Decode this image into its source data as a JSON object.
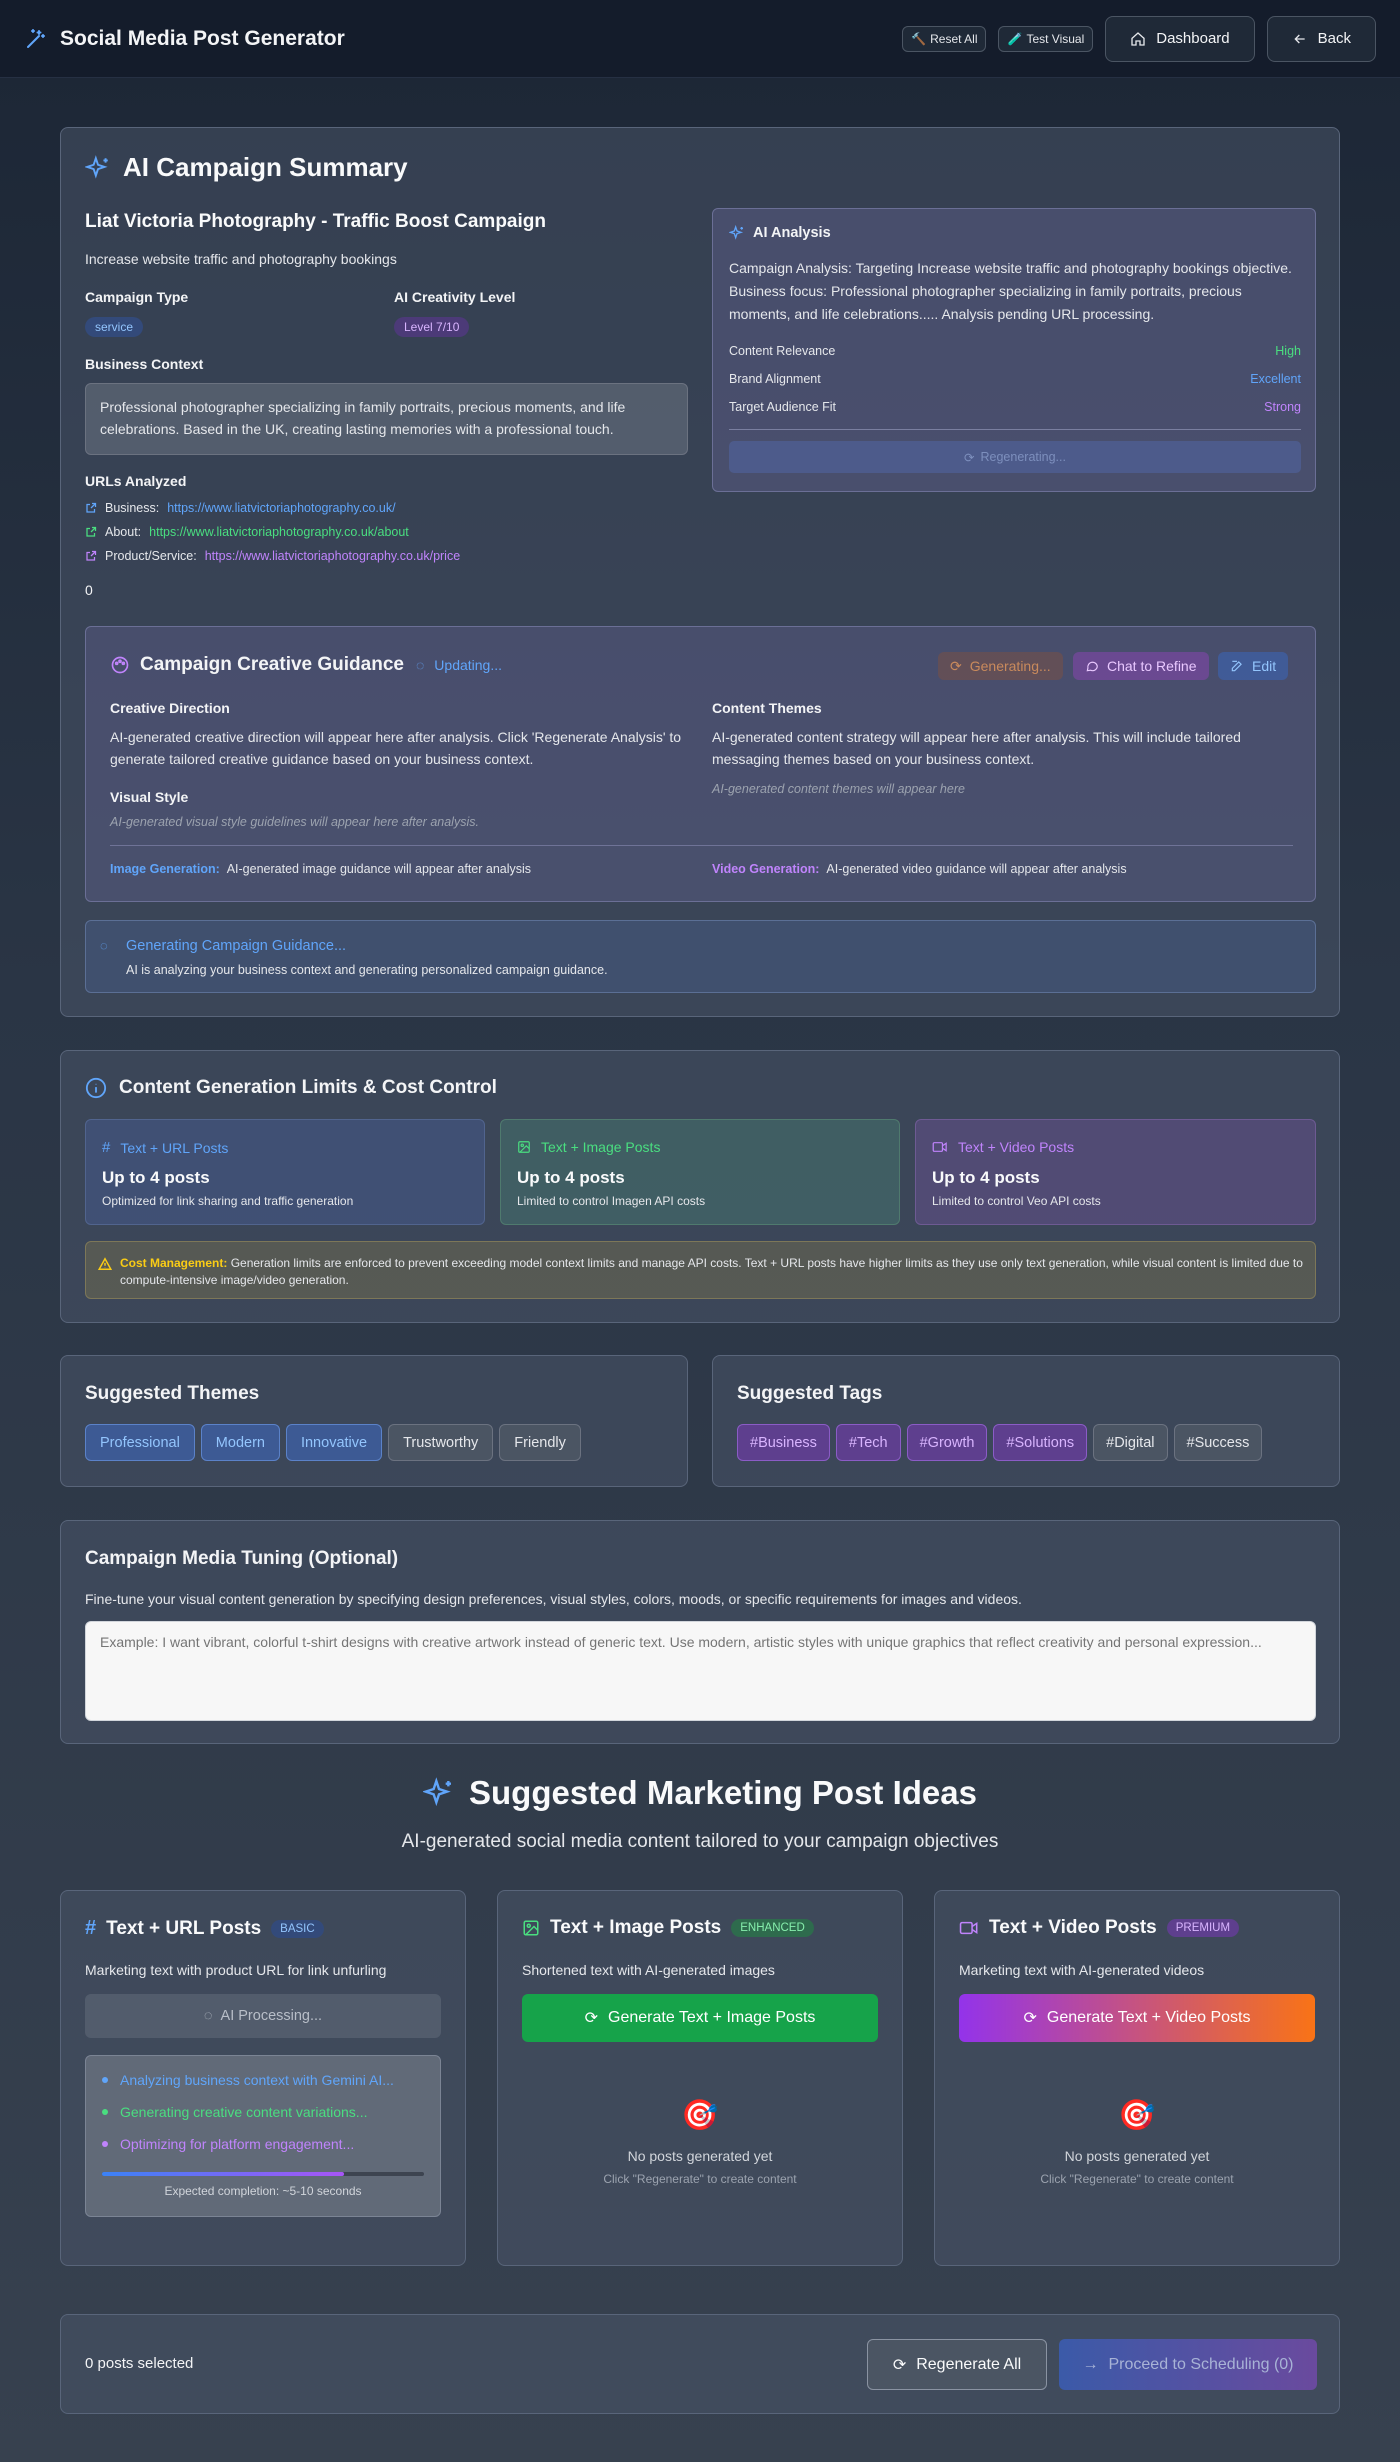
{
  "header": {
    "title": "Social Media Post Generator",
    "reset_all": "Reset All",
    "test_visual": "Test Visual",
    "dashboard": "Dashboard",
    "back": "Back"
  },
  "summary": {
    "heading": "AI Campaign Summary",
    "campaign_name": "Liat Victoria Photography - Traffic Boost Campaign",
    "objective": "Increase website traffic and photography bookings",
    "campaign_type_label": "Campaign Type",
    "campaign_type": "service",
    "creativity_label": "AI Creativity Level",
    "creativity": "Level 7/10",
    "business_context_label": "Business Context",
    "business_context": "Professional photographer specializing in family portraits, precious moments, and life celebrations. Based in the UK, creating lasting memories with a professional touch.",
    "urls_label": "URLs Analyzed",
    "urls": [
      {
        "label": "Business:",
        "url": "https://www.liatvictoriaphotography.co.uk/",
        "color": "#60a5fa"
      },
      {
        "label": "About:",
        "url": "https://www.liatvictoriaphotography.co.uk/about",
        "color": "#4ade80"
      },
      {
        "label": "Product/Service:",
        "url": "https://www.liatvictoriaphotography.co.uk/price",
        "color": "#c084fc"
      }
    ],
    "count": "0"
  },
  "ai_analysis": {
    "heading": "AI Analysis",
    "text": "Campaign Analysis: Targeting Increase website traffic and photography bookings objective. Business focus: Professional photographer specializing in family portraits, precious moments, and life celebrations..... Analysis pending URL processing.",
    "metrics": [
      {
        "name": "Content Relevance",
        "value": "High",
        "color": "#4ade80"
      },
      {
        "name": "Brand Alignment",
        "value": "Excellent",
        "color": "#60a5fa"
      },
      {
        "name": "Target Audience Fit",
        "value": "Strong",
        "color": "#c084fc"
      }
    ],
    "regen_label": "Regenerating..."
  },
  "guidance": {
    "heading": "Campaign Creative Guidance",
    "status": "Updating...",
    "generating": "Generating...",
    "chat": "Chat to Refine",
    "edit": "Edit",
    "creative_label": "Creative Direction",
    "creative_text": "AI-generated creative direction will appear here after analysis. Click 'Regenerate Analysis' to generate tailored creative guidance based on your business context.",
    "visual_label": "Visual Style",
    "visual_text": "AI-generated visual style guidelines will appear here after analysis.",
    "themes_label": "Content Themes",
    "themes_text": "AI-generated content strategy will appear here after analysis. This will include tailored messaging themes based on your business context.",
    "themes_placeholder": "AI-generated content themes will appear here",
    "image_label": "Image Generation:",
    "image_text": "AI-generated image guidance will appear after analysis",
    "video_label": "Video Generation:",
    "video_text": "AI-generated video guidance will appear after analysis"
  },
  "generating_box": {
    "title": "Generating Campaign Guidance...",
    "text": "AI is analyzing your business context and generating personalized campaign guidance."
  },
  "limits": {
    "heading": "Content Generation Limits & Cost Control",
    "cards": [
      {
        "title": "Text + URL Posts",
        "value": "Up to 4 posts",
        "desc": "Optimized for link sharing and traffic generation"
      },
      {
        "title": "Text + Image Posts",
        "value": "Up to 4 posts",
        "desc": "Limited to control Imagen API costs"
      },
      {
        "title": "Text + Video Posts",
        "value": "Up to 4 posts",
        "desc": "Limited to control Veo API costs"
      }
    ],
    "note_bold": "Cost Management:",
    "note": "Generation limits are enforced to prevent exceeding model context limits and manage API costs. Text + URL posts have higher limits as they use only text generation, while visual content is limited due to compute-intensive image/video generation."
  },
  "themes": {
    "heading": "Suggested Themes",
    "items": [
      "Professional",
      "Modern",
      "Innovative",
      "Trustworthy",
      "Friendly"
    ]
  },
  "tags": {
    "heading": "Suggested Tags",
    "items": [
      "#Business",
      "#Tech",
      "#Growth",
      "#Solutions",
      "#Digital",
      "#Success"
    ]
  },
  "tuning": {
    "heading": "Campaign Media Tuning (Optional)",
    "desc": "Fine-tune your visual content generation by specifying design preferences, visual styles, colors, moods, or specific requirements for images and videos.",
    "placeholder": "Example: I want vibrant, colorful t-shirt designs with creative artwork instead of generic text. Use modern, artistic styles with unique graphics that reflect creativity and personal expression..."
  },
  "ideas": {
    "heading": "Suggested Marketing Post Ideas",
    "subheading": "AI-generated social media content tailored to your campaign objectives"
  },
  "url_posts": {
    "title": "Text + URL Posts",
    "badge": "BASIC",
    "desc": "Marketing text with product URL for link unfurling",
    "processing": "AI Processing...",
    "steps": [
      "Analyzing business context with Gemini AI...",
      "Generating creative content variations...",
      "Optimizing for platform engagement..."
    ],
    "progress": 0.75,
    "eta": "Expected completion: ~5-10 seconds"
  },
  "image_posts": {
    "title": "Text + Image Posts",
    "badge": "ENHANCED",
    "desc": "Shortened text with AI-generated images",
    "button": "Generate Text + Image Posts",
    "empty": "No posts generated yet",
    "hint": "Click \"Regenerate\" to create content"
  },
  "video_posts": {
    "title": "Text + Video Posts",
    "badge": "PREMIUM",
    "desc": "Marketing text with AI-generated videos",
    "button": "Generate Text + Video Posts",
    "empty": "No posts generated yet",
    "hint": "Click \"Regenerate\" to create content"
  },
  "footer": {
    "selected": "0 posts selected",
    "regenerate": "Regenerate All",
    "proceed": "Proceed to Scheduling (0)"
  }
}
